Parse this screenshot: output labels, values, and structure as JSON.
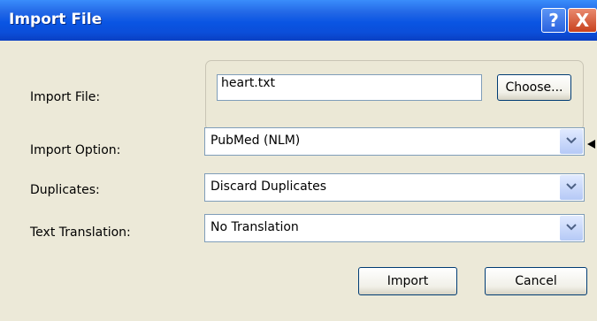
{
  "window": {
    "title": "Import File",
    "help_glyph": "?",
    "close_glyph": "X"
  },
  "labels": {
    "import_file": "Import File:",
    "import_option": "Import Option:",
    "duplicates": "Duplicates:",
    "text_translation": "Text Translation:"
  },
  "file": {
    "value": "heart.txt",
    "choose_label": "Choose..."
  },
  "selects": {
    "import_option": "PubMed (NLM)",
    "duplicates": "Discard Duplicates",
    "text_translation": "No Translation"
  },
  "buttons": {
    "import": "Import",
    "cancel": "Cancel"
  },
  "colors": {
    "titlebar": "#0a55e3",
    "dialog_bg": "#ece9d8",
    "close_button": "#c8421e"
  }
}
